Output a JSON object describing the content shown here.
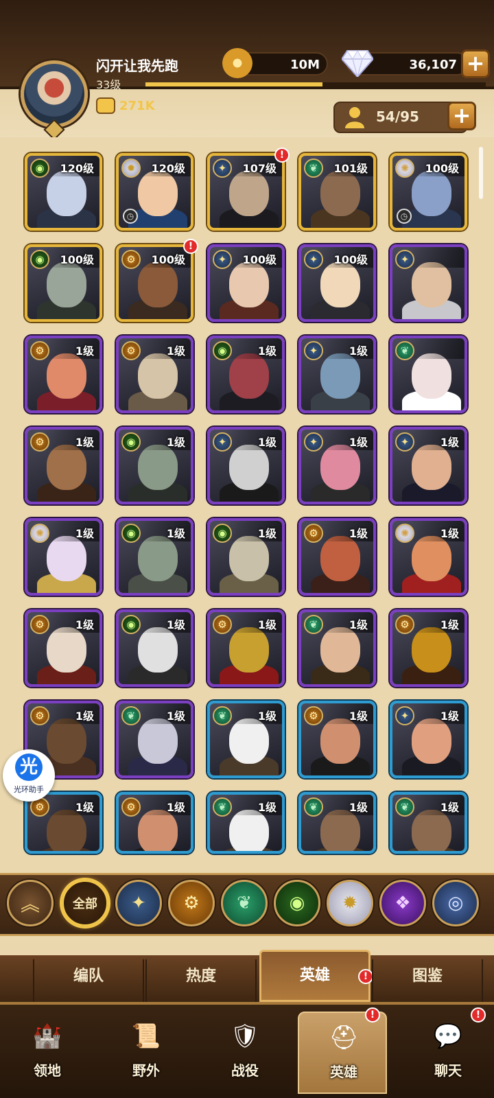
{
  "header": {
    "player_name": "闪开让我先跑",
    "player_level": "33级",
    "xp_progress": 0.52,
    "power": "271K",
    "gold": "10M",
    "gems": "36,107",
    "roster": "54/95",
    "avatar_icon": "player-avatar",
    "power_icon": "fist-icon",
    "gold_icon": "gold-coin-icon",
    "gem_icon": "diamond-icon",
    "roster_icon": "person-icon",
    "plus_label": "+"
  },
  "heroes": [
    {
      "level": "120级",
      "faction": "forest",
      "rarity": "gold",
      "clock": false,
      "alert": false,
      "skin": "#c6d0e6",
      "cloth": "#2b3346"
    },
    {
      "level": "120级",
      "faction": "celestial",
      "rarity": "gold",
      "clock": true,
      "alert": false,
      "skin": "#f0c9a4",
      "cloth": "#214070"
    },
    {
      "level": "107级",
      "faction": "lightbearer",
      "rarity": "gold",
      "clock": false,
      "alert": true,
      "skin": "#bfa58a",
      "cloth": "#1a1a1f"
    },
    {
      "level": "101级",
      "faction": "wilder",
      "rarity": "gold",
      "clock": false,
      "alert": false,
      "skin": "#8c6a50",
      "cloth": "#4a3520"
    },
    {
      "level": "100级",
      "faction": "celestial-star",
      "rarity": "gold",
      "clock": true,
      "alert": false,
      "skin": "#8aa0c8",
      "cloth": "#2a3550"
    },
    {
      "level": "100级",
      "faction": "graveborn",
      "rarity": "gold",
      "clock": false,
      "alert": false,
      "skin": "#9aa59a",
      "cloth": "#2e352e"
    },
    {
      "level": "100级",
      "faction": "mauler",
      "rarity": "gold",
      "clock": false,
      "alert": true,
      "skin": "#8a5a3a",
      "cloth": "#3a2a20"
    },
    {
      "level": "100级",
      "faction": "lightbearer",
      "rarity": "purple",
      "clock": false,
      "alert": false,
      "skin": "#e8c9b0",
      "cloth": "#5a2a20"
    },
    {
      "level": "100级",
      "faction": "lightbearer",
      "rarity": "purple",
      "clock": false,
      "alert": false,
      "skin": "#f0d8b8",
      "cloth": "#2a2a30"
    },
    {
      "level": "",
      "faction": "lightbearer",
      "rarity": "purple",
      "clock": false,
      "alert": false,
      "skin": "#e0c0a0",
      "cloth": "#c8c8cc"
    },
    {
      "level": "1级",
      "faction": "mauler",
      "rarity": "purple",
      "clock": false,
      "alert": false,
      "skin": "#e08a6a",
      "cloth": "#7a1f2a"
    },
    {
      "level": "1级",
      "faction": "mauler",
      "rarity": "purple",
      "clock": false,
      "alert": false,
      "skin": "#d6c4a8",
      "cloth": "#6a5a48"
    },
    {
      "level": "1级",
      "faction": "graveborn",
      "rarity": "purple",
      "clock": false,
      "alert": false,
      "skin": "#a04048",
      "cloth": "#1c1c22"
    },
    {
      "level": "1级",
      "faction": "lightbearer",
      "rarity": "purple",
      "clock": false,
      "alert": false,
      "skin": "#7a9ab8",
      "cloth": "#3a4048"
    },
    {
      "level": "",
      "faction": "wilder",
      "rarity": "purple",
      "clock": false,
      "alert": false,
      "skin": "#f0e0e0",
      "cloth": "#ffffff"
    },
    {
      "level": "1级",
      "faction": "mauler",
      "rarity": "purple",
      "clock": false,
      "alert": false,
      "skin": "#a0704a",
      "cloth": "#3a2418"
    },
    {
      "level": "1级",
      "faction": "graveborn",
      "rarity": "purple",
      "clock": false,
      "alert": false,
      "skin": "#8a9a88",
      "cloth": "#2a2e2a"
    },
    {
      "level": "1级",
      "faction": "lightbearer",
      "rarity": "purple",
      "clock": false,
      "alert": false,
      "skin": "#d0d0d0",
      "cloth": "#1a1a1a"
    },
    {
      "level": "1级",
      "faction": "lightbearer",
      "rarity": "purple",
      "clock": false,
      "alert": false,
      "skin": "#e08aa0",
      "cloth": "#2a2a2a"
    },
    {
      "level": "1级",
      "faction": "lightbearer",
      "rarity": "purple",
      "clock": false,
      "alert": false,
      "skin": "#e0b090",
      "cloth": "#1a1a2a"
    },
    {
      "level": "1级",
      "faction": "celestial-star",
      "rarity": "purple",
      "clock": false,
      "alert": false,
      "skin": "#e8d8f0",
      "cloth": "#c8a84a"
    },
    {
      "level": "1级",
      "faction": "graveborn",
      "rarity": "purple",
      "clock": false,
      "alert": false,
      "skin": "#8a9a88",
      "cloth": "#4a5048"
    },
    {
      "level": "1级",
      "faction": "graveborn",
      "rarity": "purple",
      "clock": false,
      "alert": false,
      "skin": "#c8c0a8",
      "cloth": "#6a6048"
    },
    {
      "level": "1级",
      "faction": "mauler",
      "rarity": "purple",
      "clock": false,
      "alert": false,
      "skin": "#c06040",
      "cloth": "#3a2018"
    },
    {
      "level": "1级",
      "faction": "celestial-star",
      "rarity": "purple",
      "clock": false,
      "alert": false,
      "skin": "#e09060",
      "cloth": "#a02020"
    },
    {
      "level": "1级",
      "faction": "mauler",
      "rarity": "purple",
      "clock": false,
      "alert": false,
      "skin": "#e8d8c8",
      "cloth": "#6a2018"
    },
    {
      "level": "1级",
      "faction": "graveborn",
      "rarity": "purple",
      "clock": false,
      "alert": false,
      "skin": "#e0e0e0",
      "cloth": "#2a2a2a"
    },
    {
      "level": "1级",
      "faction": "mauler",
      "rarity": "purple",
      "clock": false,
      "alert": false,
      "skin": "#c8a030",
      "cloth": "#8a1818"
    },
    {
      "level": "1级",
      "faction": "wilder",
      "rarity": "purple",
      "clock": false,
      "alert": false,
      "skin": "#e0b898",
      "cloth": "#3a2a18"
    },
    {
      "level": "1级",
      "faction": "mauler",
      "rarity": "purple",
      "clock": false,
      "alert": false,
      "skin": "#c8901a",
      "cloth": "#3a2010"
    },
    {
      "level": "1级",
      "faction": "mauler",
      "rarity": "purple",
      "clock": false,
      "alert": false,
      "skin": "#6a4a30",
      "cloth": "#4a3020"
    },
    {
      "level": "1级",
      "faction": "wilder",
      "rarity": "purple",
      "clock": false,
      "alert": false,
      "skin": "#c8c8d8",
      "cloth": "#2a2a48"
    },
    {
      "level": "1级",
      "faction": "wilder",
      "rarity": "blue",
      "clock": false,
      "alert": false,
      "skin": "#f0f0f0",
      "cloth": "#4a3a2a"
    },
    {
      "level": "1级",
      "faction": "mauler",
      "rarity": "blue",
      "clock": false,
      "alert": false,
      "skin": "#d09070",
      "cloth": "#1a1a1a"
    },
    {
      "level": "1级",
      "faction": "lightbearer",
      "rarity": "blue",
      "clock": false,
      "alert": false,
      "skin": "#e0a080",
      "cloth": "#1a1a22"
    },
    {
      "level": "1级",
      "faction": "mauler",
      "rarity": "blue",
      "clock": false,
      "alert": false,
      "skin": "#6a4a30",
      "cloth": "#4a3020"
    },
    {
      "level": "1级",
      "faction": "mauler",
      "rarity": "blue",
      "clock": false,
      "alert": false,
      "skin": "#d09070",
      "cloth": "#1a1a1a"
    },
    {
      "level": "1级",
      "faction": "wilder",
      "rarity": "blue",
      "clock": false,
      "alert": false,
      "skin": "#f0f0f0",
      "cloth": "#4a3a2a"
    },
    {
      "level": "1级",
      "faction": "wilder",
      "rarity": "blue",
      "clock": false,
      "alert": false,
      "skin": "#8c6a50",
      "cloth": "#4a3520"
    },
    {
      "level": "1级",
      "faction": "wilder",
      "rarity": "blue",
      "clock": false,
      "alert": false,
      "skin": "#8c6a50",
      "cloth": "#4a3520"
    }
  ],
  "helper": {
    "glyph": "光",
    "label": "光环助手"
  },
  "filters": {
    "collapse_icon": "double-chevron-up-icon",
    "all_label": "全部",
    "factions": [
      "lightbearer",
      "mauler",
      "wilder",
      "graveborn",
      "celestial",
      "hypogean",
      "dimensional"
    ]
  },
  "subtabs": [
    {
      "label": "编队",
      "active": false,
      "alert": false
    },
    {
      "label": "热度",
      "active": false,
      "alert": false
    },
    {
      "label": "英雄",
      "active": true,
      "alert": true
    },
    {
      "label": "图鉴",
      "active": false,
      "alert": false
    }
  ],
  "nav": [
    {
      "label": "领地",
      "icon": "castle-icon",
      "active": false,
      "alert": false
    },
    {
      "label": "野外",
      "icon": "scroll-map-icon",
      "active": false,
      "alert": false
    },
    {
      "label": "战役",
      "icon": "campaign-shield-icon",
      "active": false,
      "alert": false
    },
    {
      "label": "英雄",
      "icon": "helmet-icon",
      "active": true,
      "alert": true
    },
    {
      "label": "聊天",
      "icon": "chat-bubble-icon",
      "active": false,
      "alert": true
    }
  ],
  "colors": {
    "accent_gold": "#f2c54a",
    "alert_red": "#e22a2a",
    "rarity_gold": "#e7b73b",
    "rarity_purple": "#7b3fc1",
    "rarity_blue": "#2e9bd1"
  }
}
